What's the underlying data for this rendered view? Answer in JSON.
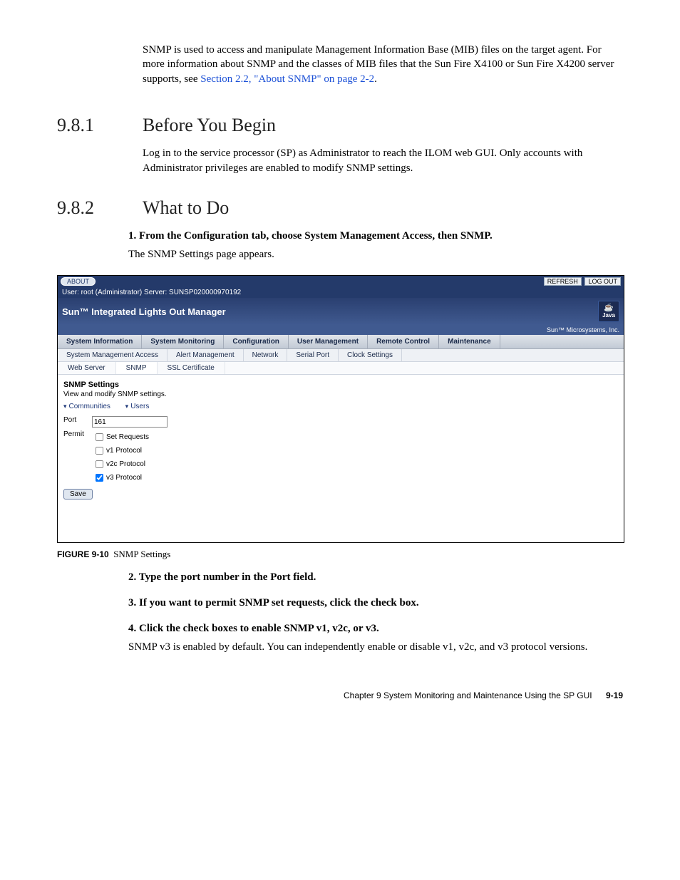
{
  "intro": {
    "text": "SNMP is used to access and manipulate Management Information Base (MIB) files on the target agent. For more information about SNMP and the classes of MIB files that the Sun Fire X4100 or Sun Fire X4200 server supports, see ",
    "link": "Section 2.2, \"About SNMP\" on page 2-2",
    "tail": "."
  },
  "section1": {
    "num": "9.8.1",
    "title": "Before You Begin",
    "body": "Log in to the service processor (SP) as Administrator to reach the ILOM web GUI. Only accounts with Administrator privileges are enabled to modify SNMP settings."
  },
  "section2": {
    "num": "9.8.2",
    "title": "What to Do"
  },
  "steps": {
    "s1": {
      "num": "1.",
      "bold": "From the Configuration tab, choose System Management Access, then SNMP.",
      "sub": "The SNMP Settings page appears."
    },
    "s2": {
      "num": "2.",
      "bold": "Type the port number in the Port field."
    },
    "s3": {
      "num": "3.",
      "bold": "If you want to permit SNMP set requests, click the check box."
    },
    "s4": {
      "num": "4.",
      "bold": "Click the check boxes to enable SNMP v1, v2c, or v3.",
      "sub": "SNMP v3 is enabled by default. You can independently enable or disable v1, v2c, and v3 protocol versions."
    }
  },
  "figcap": {
    "label": "FIGURE 9-10",
    "text": "SNMP Settings"
  },
  "footer": {
    "chapter": "Chapter 9    System Monitoring and Maintenance Using the SP GUI",
    "page": "9-19"
  },
  "shot": {
    "about": "ABOUT",
    "refresh": "REFRESH",
    "logout": "LOG OUT",
    "userline": "User: root (Administrator)   Server: SUNSP020000970192",
    "title": "Sun™ Integrated Lights Out Manager",
    "java": "Java",
    "trademark": "Sun™ Microsystems, Inc.",
    "tabs1": [
      "System Information",
      "System Monitoring",
      "Configuration",
      "User Management",
      "Remote Control",
      "Maintenance"
    ],
    "tabs2": [
      "System Management Access",
      "Alert Management",
      "Network",
      "Serial Port",
      "Clock Settings"
    ],
    "tabs3": [
      "Web Server",
      "SNMP",
      "SSL Certificate"
    ],
    "settings_title": "SNMP Settings",
    "settings_desc": "View and modify SNMP settings.",
    "link_comm": "Communities",
    "link_users": "Users",
    "port_label": "Port",
    "port_value": "161",
    "permit_label": "Permit",
    "cb_set": "Set Requests",
    "cb_v1": "v1 Protocol",
    "cb_v2c": "v2c Protocol",
    "cb_v3": "v3 Protocol",
    "save": "Save"
  }
}
